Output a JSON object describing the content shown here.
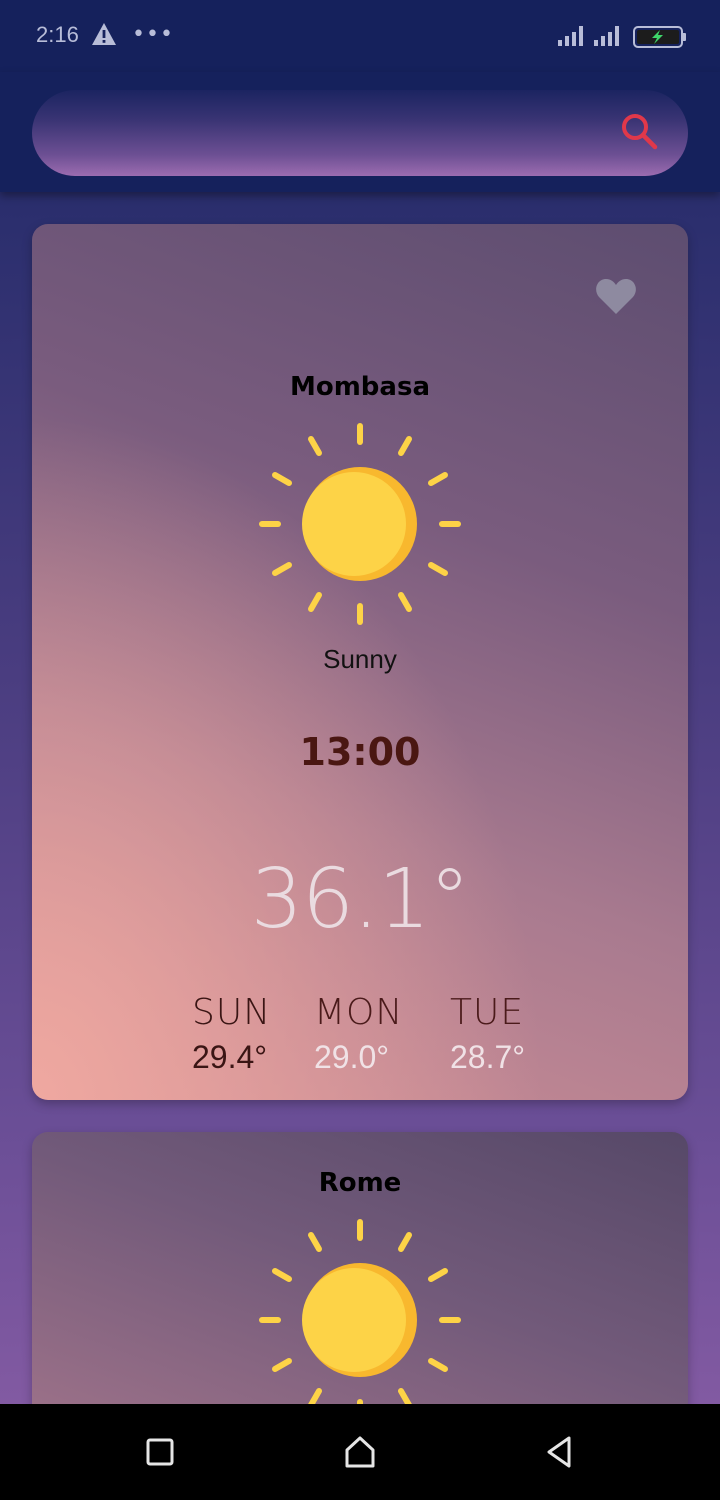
{
  "status_bar": {
    "time": "2:16",
    "more": "•••",
    "icons": [
      "warning-icon",
      "signal-icon",
      "signal-icon",
      "battery-charging-icon"
    ]
  },
  "search": {
    "placeholder": "",
    "value": "",
    "icon": "search-icon",
    "icon_color": "#e0384a"
  },
  "cards": [
    {
      "city": "Mombasa",
      "condition": "Sunny",
      "time": "13:00",
      "temp": "36.1°",
      "favorite_icon": "heart-icon",
      "weather_icon": "sun-icon",
      "forecast": [
        {
          "day": "SUN",
          "temp": "29.4°"
        },
        {
          "day": "MON",
          "temp": "29.0°"
        },
        {
          "day": "TUE",
          "temp": "28.7°"
        }
      ]
    },
    {
      "city": "Rome",
      "weather_icon": "sun-icon"
    }
  ],
  "nav": {
    "icons": [
      "recent-apps-icon",
      "home-icon",
      "back-icon"
    ]
  },
  "colors": {
    "sun": "#fdd347",
    "sun_shade": "#f8b82e",
    "heart": "#8e8aa0",
    "header": "#15215c"
  }
}
